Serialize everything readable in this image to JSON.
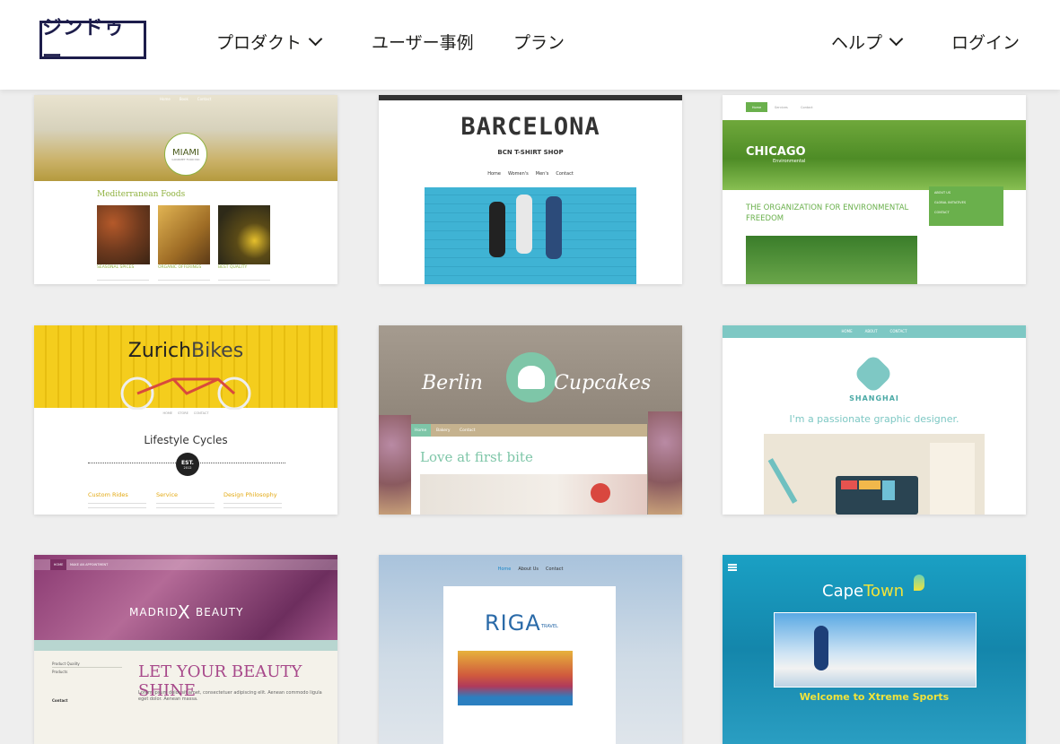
{
  "header": {
    "logo": "ジンドゥー",
    "nav": {
      "products": "プロダクト",
      "cases": "ユーザー事例",
      "plans": "プラン",
      "help": "ヘルプ",
      "login": "ログイン"
    }
  },
  "templates": {
    "miami": {
      "nav": [
        "Home",
        "Book",
        "Contact"
      ],
      "logo": "MIAMI",
      "logo_sub": "GOURMET FOOD INC",
      "heading": "Mediterranean Foods",
      "labels": [
        "SEASONAL SPICES",
        "ORGANIC OFFERINGS",
        "BEST QUALITY"
      ]
    },
    "barcelona": {
      "title": "BARCELONA",
      "subtitle": "BCN T-SHIRT SHOP",
      "nav": [
        "Home",
        "Women's",
        "Men's",
        "Contact"
      ]
    },
    "chicago": {
      "nav": [
        "Home",
        "Services",
        "Contact"
      ],
      "logo": "CHICAGO",
      "logo_sub": "Environmental",
      "headline": "THE ORGANIZATION FOR ENVIRONMENTAL FREEDOM",
      "menu": [
        "ABOUT US",
        "GLOBAL INITIATIVES",
        "CONTACT"
      ]
    },
    "zurich": {
      "logo_a": "Zurich",
      "logo_b": "Bikes",
      "nav": [
        "HOME",
        "STORE",
        "CONTACT"
      ],
      "heading": "Lifestyle Cycles",
      "badge": "EST.",
      "badge_year": "2012",
      "columns": [
        "Custom Rides",
        "Service",
        "Design Philosophy"
      ]
    },
    "berlin": {
      "logo_a": "Berlin",
      "logo_b": "Cupcakes",
      "nav": [
        "Home",
        "Bakery",
        "Contact"
      ],
      "headline": "Love at first bite"
    },
    "shanghai": {
      "nav": [
        "HOME",
        "ABOUT",
        "CONTACT"
      ],
      "name": "SHANGHAI",
      "tagline": "I'm a passionate graphic designer."
    },
    "madrid": {
      "nav": [
        "HOME",
        "MAKE AN APPOINTMENT"
      ],
      "logo_a": "MADRID",
      "logo_b": "BEAUTY",
      "sidebar": [
        "Product Quality",
        "Products"
      ],
      "contact": "Contact",
      "headline": "LET YOUR BEAUTY SHINE",
      "body": "Lorem ipsum dolor sit amet, consectetuer adipiscing elit. Aenean commodo ligula eget dolor. Aenean massa."
    },
    "riga": {
      "nav": [
        "Home",
        "About Us",
        "Contact"
      ],
      "logo": "RIGA",
      "logo_sub": "TRAVEL"
    },
    "capetown": {
      "logo_a": "Cape",
      "logo_b": "Town",
      "headline": "Welcome to Xtreme Sports"
    }
  },
  "colors": {
    "brand": "#1d1d4b",
    "miami_green": "#8fb13f",
    "chicago_green": "#6ab04c",
    "zurich_yellow": "#f4cd1d",
    "shanghai_teal": "#7ec8c4",
    "capetown_blue": "#1aa0c4"
  }
}
